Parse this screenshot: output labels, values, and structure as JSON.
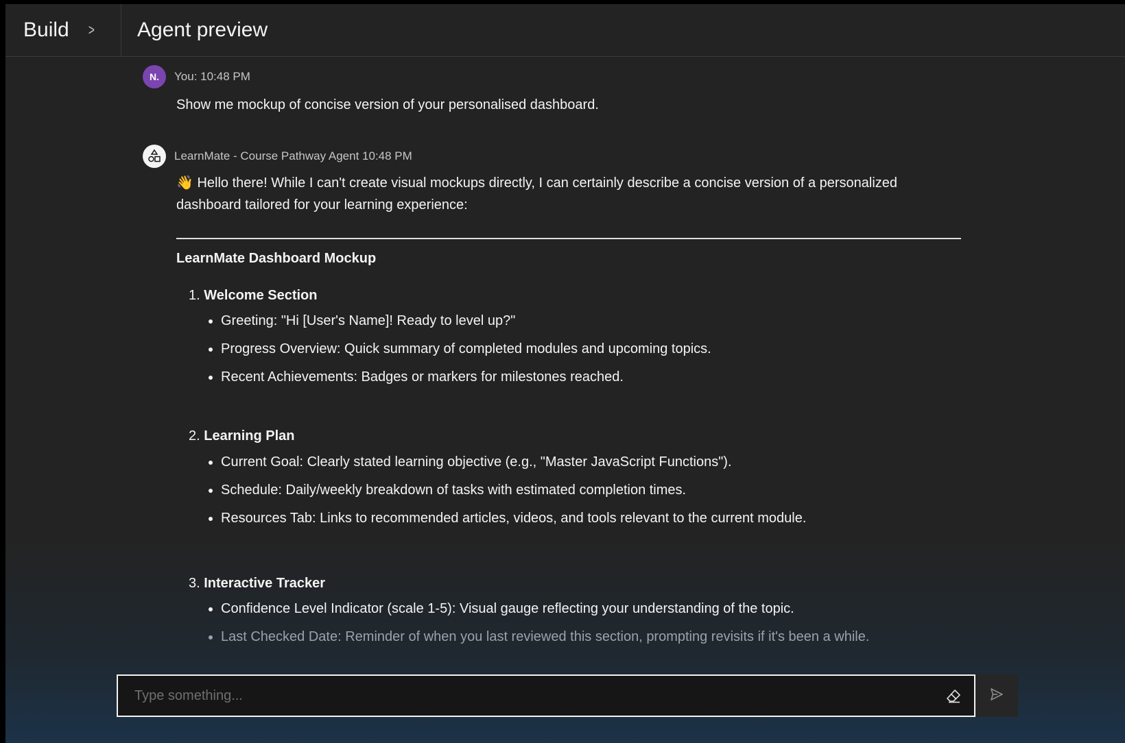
{
  "header": {
    "breadcrumb_label": "Build",
    "title": "Agent preview"
  },
  "messages": {
    "user": {
      "avatar_initials": "N.",
      "meta": "You: 10:48 PM",
      "text": "Show me mockup of concise version of your personalised dashboard."
    },
    "agent": {
      "meta": "LearnMate - Course Pathway Agent 10:48 PM",
      "intro": "👋 Hello there! While I can't create visual mockups directly, I can certainly describe a concise version of a personalized dashboard tailored for your learning experience:",
      "heading": "LearnMate Dashboard Mockup",
      "sections": [
        {
          "number": "1.",
          "title": "Welcome Section",
          "items": [
            "Greeting: \"Hi [User's Name]! Ready to level up?\"",
            "Progress Overview: Quick summary of completed modules and upcoming topics.",
            "Recent Achievements: Badges or markers for milestones reached."
          ]
        },
        {
          "number": "2.",
          "title": "Learning Plan",
          "items": [
            "Current Goal: Clearly stated learning objective (e.g., \"Master JavaScript Functions\").",
            "Schedule: Daily/weekly breakdown of tasks with estimated completion times.",
            "Resources Tab: Links to recommended articles, videos, and tools relevant to the current module."
          ]
        },
        {
          "number": "3.",
          "title": "Interactive Tracker",
          "items": [
            "Confidence Level Indicator (scale 1-5): Visual gauge reflecting your understanding of the topic.",
            "Last Checked Date: Reminder of when you last reviewed this section, prompting revisits if it's been a while."
          ]
        }
      ]
    }
  },
  "composer": {
    "placeholder": "Type something..."
  },
  "colors": {
    "accent": "#2f6df2",
    "user_avatar": "#7b45b0",
    "background": "#232323"
  }
}
